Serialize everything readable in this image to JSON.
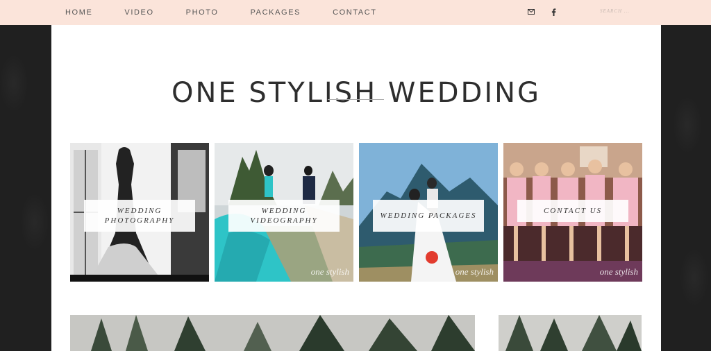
{
  "nav": {
    "items": [
      "HOME",
      "VIDEO",
      "PHOTO",
      "PACKAGES",
      "CONTACT"
    ],
    "search_placeholder": "SEARCH ..."
  },
  "social": [
    {
      "icon": "email-icon"
    },
    {
      "icon": "facebook-icon"
    }
  ],
  "site": {
    "title": "ONE STYLISH WEDDING"
  },
  "tiles": [
    {
      "label": "WEDDING PHOTOGRAPHY"
    },
    {
      "label": "WEDDING VIDEOGRAPHY"
    },
    {
      "label": "WEDDING PACKAGES"
    },
    {
      "label": "CONTACT US"
    }
  ],
  "watermark": "one stylish",
  "colors": {
    "nav_bg": "#fbe4da",
    "page_bg": "#202020",
    "content_bg": "#ffffff",
    "text": "#2e2e2e"
  }
}
